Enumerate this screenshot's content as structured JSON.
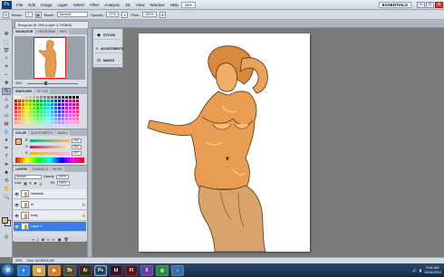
{
  "menubar": {
    "logo": "Ps",
    "items": [
      "File",
      "Edit",
      "Image",
      "Layer",
      "Select",
      "Filter",
      "Analysis",
      "3D",
      "View",
      "Window",
      "Help"
    ],
    "zoom": "33%",
    "workspace": "ESSENTIALS",
    "window_controls": {
      "minimize": "–",
      "maximize": "□",
      "close": "✕"
    }
  },
  "options": {
    "tool_label": "Brush:",
    "brush_size": "1",
    "mode_label": "Mode:",
    "mode_value": "Normal",
    "opacity_label": "Opacity:",
    "opacity_value": "57%",
    "flow_label": "Flow:",
    "flow_value": "100%"
  },
  "document": {
    "tab_label": "Bony.psd @ 25% (Layer 4, RGB/8)"
  },
  "panels": {
    "navigator": {
      "tabs": [
        "NAVIGATOR",
        "HISTOGRAM",
        "INFO"
      ],
      "zoom": "25%"
    },
    "swatches": {
      "tabs": [
        "SWATCHES",
        "STYLES"
      ]
    },
    "color": {
      "tabs": [
        "COLOR",
        "ADJUSTMENTS",
        "MASKS"
      ],
      "channels": [
        {
          "letter": "R",
          "value": "242"
        },
        {
          "letter": "G",
          "value": "183"
        },
        {
          "letter": "B",
          "value": "127"
        }
      ]
    },
    "layers": {
      "tabs": [
        "LAYERS",
        "CHANNELS",
        "PATHS"
      ],
      "blend_mode": "Normal",
      "opacity_label": "Opacity:",
      "opacity_value": "100%",
      "lock_label": "Lock:",
      "fill_label": "Fill:",
      "fill_value": "100%",
      "rows": [
        {
          "name": "shadows",
          "selected": false
        },
        {
          "name": "hl",
          "selected": false
        },
        {
          "name": "body",
          "selected": false
        },
        {
          "name": "Layer 4",
          "selected": true
        }
      ]
    }
  },
  "dock": {
    "items": [
      {
        "label": "STYLES",
        "icon": "styles-icon"
      },
      {
        "label": "ADJUSTMENTS",
        "icon": "adjustments-icon"
      },
      {
        "label": "MASKS",
        "icon": "masks-icon"
      }
    ]
  },
  "status": {
    "zoom": "25%",
    "doc_size": "Doc: 18.2M/78.4M"
  },
  "taskbar": {
    "apps": [
      {
        "label": "e",
        "icon": "ie-icon",
        "color": "#2f7fd8"
      },
      {
        "label": "▤",
        "icon": "explorer-icon",
        "color": "#d7a43a"
      },
      {
        "label": "▶",
        "icon": "media-player-icon",
        "color": "#e07a1f"
      },
      {
        "label": "Br",
        "icon": "bridge-icon",
        "color": "#5b4a2e"
      },
      {
        "label": "Ai",
        "icon": "illustrator-icon",
        "color": "#3a2a10"
      },
      {
        "label": "Ps",
        "icon": "photoshop-icon",
        "color": "#10315d"
      },
      {
        "label": "Id",
        "icon": "indesign-icon",
        "color": "#3a0f2c"
      },
      {
        "label": "Fl",
        "icon": "flash-icon",
        "color": "#5a1212"
      },
      {
        "label": "X",
        "icon": "app-x-icon",
        "color": "#6a3ea1"
      },
      {
        "label": "◎",
        "icon": "chrome-icon",
        "color": "#2b8a3e"
      },
      {
        "label": "♪",
        "icon": "media-icon",
        "color": "#3c6fa8"
      }
    ],
    "time": "9:41 AM",
    "date": "10/28/2012"
  },
  "colors": {
    "foreground": "#f2b777",
    "background": "#ffffff",
    "selection": "#3a7ee3"
  }
}
